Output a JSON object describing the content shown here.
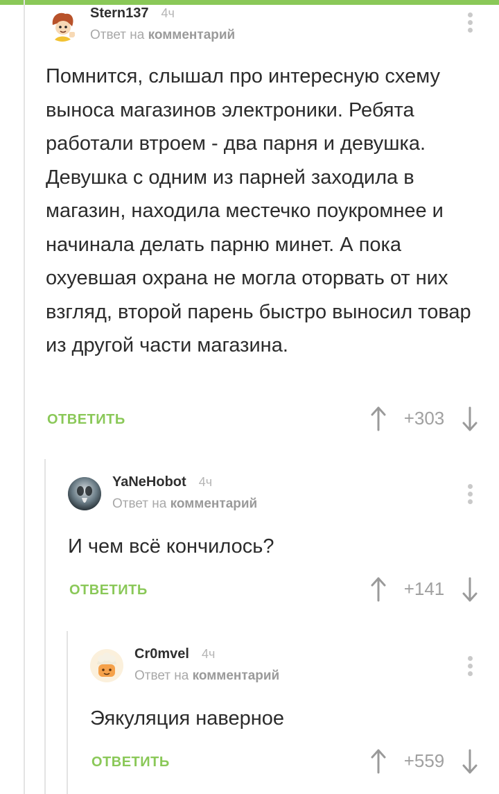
{
  "comments": [
    {
      "username": "Stern137",
      "time": "4ч",
      "reply_prefix": "Ответ на",
      "reply_link": "комментарий",
      "text": "Помнится, слышал про интересную схему выноса магазинов электроники. Ребята работали втроем - два парня и девушка. Девушка с одним из парней заходила в магазин, находила местечко поукромнее и начинала делать парню минет. А пока охуевшая охрана не могла оторвать от них взгляд, второй парень быстро выносил товар из другой части магазина.",
      "reply_label": "ОТВЕТИТЬ",
      "score": "+303"
    },
    {
      "username": "YaNeHobot",
      "time": "4ч",
      "reply_prefix": "Ответ на",
      "reply_link": "комментарий",
      "text": "И чем всё кончилось?",
      "reply_label": "ОТВЕТИТЬ",
      "score": "+141"
    },
    {
      "username": "Cr0mvel",
      "time": "4ч",
      "reply_prefix": "Ответ на",
      "reply_link": "комментарий",
      "text": "Эякуляция наверное",
      "reply_label": "ОТВЕТИТЬ",
      "score": "+559"
    }
  ],
  "colors": {
    "accent": "#8ac858",
    "muted": "#a8a8a8",
    "text": "#2b2b2b"
  },
  "icons": [
    "arrow-up-icon",
    "arrow-down-icon",
    "more-vertical-icon",
    "avatar"
  ]
}
